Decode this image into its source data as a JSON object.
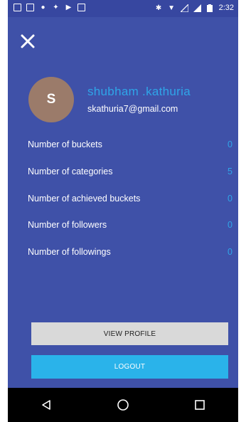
{
  "status_bar": {
    "time": "2:32",
    "left_icons": [
      "f-icon",
      "msg-icon",
      "reddit-icon",
      "notification-icon",
      "play-icon",
      "doc-icon"
    ],
    "right_icons": [
      "bluetooth-icon",
      "wifi-icon",
      "signal-icon",
      "signal-2-icon",
      "battery-icon"
    ]
  },
  "profile": {
    "avatar_letter": "S",
    "name": "shubham .kathuria",
    "email": "skathuria7@gmail.com",
    "accent_color": "#2fa5e8",
    "avatar_color": "#9b7b6a"
  },
  "stats": [
    {
      "label": "Number of buckets",
      "value": "0"
    },
    {
      "label": "Number of categories",
      "value": "5"
    },
    {
      "label": "Number of achieved buckets",
      "value": "0"
    },
    {
      "label": "Number of followers",
      "value": "0"
    },
    {
      "label": "Number of followings",
      "value": "0"
    }
  ],
  "buttons": {
    "view_profile": "VIEW PROFILE",
    "logout": "LOGOUT"
  },
  "nav": {
    "back": "back-icon",
    "home": "home-icon",
    "recents": "recents-icon"
  },
  "colors": {
    "background": "#3f51a8",
    "status_bar": "#3747a0",
    "logout": "#2ab3ea",
    "view_profile": "#d9d9d9"
  }
}
